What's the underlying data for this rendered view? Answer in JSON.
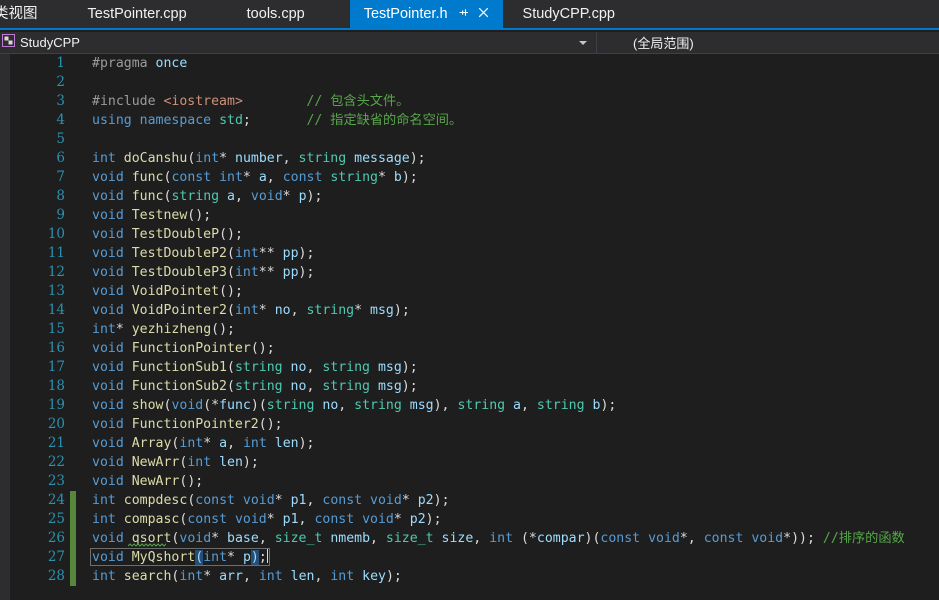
{
  "window": {
    "accent_color": "#007acc",
    "background": "#1e1e1e",
    "chrome_background": "#2d2d30"
  },
  "tabstrip": {
    "tabs": [
      {
        "label": "类视图",
        "active": false,
        "pinned": false
      },
      {
        "label": "TestPointer.cpp",
        "active": false,
        "pinned": false
      },
      {
        "label": "tools.cpp",
        "active": false,
        "pinned": false
      },
      {
        "label": "TestPointer.h",
        "active": true,
        "pinned": true
      },
      {
        "label": "StudyCPP.cpp",
        "active": false,
        "pinned": false
      }
    ],
    "pin_icon": "pin-icon",
    "close_icon": "close-icon"
  },
  "navbar": {
    "project_icon": "project-icon",
    "project_name": "StudyCPP",
    "scope": "(全局范围)",
    "dropdown_icon": "chevron-down-icon"
  },
  "editor": {
    "line_number_color": "#2b91af",
    "change_bar_color": "#57873a",
    "first_visible_line": 1,
    "lines": [
      {
        "n": 1,
        "changed": false,
        "text": "#pragma once"
      },
      {
        "n": 2,
        "changed": false,
        "text": ""
      },
      {
        "n": 3,
        "changed": false,
        "text": "#include <iostream>        // 包含头文件。"
      },
      {
        "n": 4,
        "changed": false,
        "text": "using namespace std;       // 指定缺省的命名空间。"
      },
      {
        "n": 5,
        "changed": false,
        "text": ""
      },
      {
        "n": 6,
        "changed": false,
        "text": "int doCanshu(int* number, string message);"
      },
      {
        "n": 7,
        "changed": false,
        "text": "void func(const int* a, const string* b);"
      },
      {
        "n": 8,
        "changed": false,
        "text": "void func(string a, void* p);"
      },
      {
        "n": 9,
        "changed": false,
        "text": "void Testnew();"
      },
      {
        "n": 10,
        "changed": false,
        "text": "void TestDoubleP();"
      },
      {
        "n": 11,
        "changed": false,
        "text": "void TestDoubleP2(int** pp);"
      },
      {
        "n": 12,
        "changed": false,
        "text": "void TestDoubleP3(int** pp);"
      },
      {
        "n": 13,
        "changed": false,
        "text": "void VoidPointet();"
      },
      {
        "n": 14,
        "changed": false,
        "text": "void VoidPointer2(int* no, string* msg);"
      },
      {
        "n": 15,
        "changed": false,
        "text": "int* yezhizheng();"
      },
      {
        "n": 16,
        "changed": false,
        "text": "void FunctionPointer();"
      },
      {
        "n": 17,
        "changed": false,
        "text": "void FunctionSub1(string no, string msg);"
      },
      {
        "n": 18,
        "changed": false,
        "text": "void FunctionSub2(string no, string msg);"
      },
      {
        "n": 19,
        "changed": false,
        "text": "void show(void(*func)(string no, string msg), string a, string b);"
      },
      {
        "n": 20,
        "changed": false,
        "text": "void FunctionPointer2();"
      },
      {
        "n": 21,
        "changed": false,
        "text": "void Array(int* a, int len);"
      },
      {
        "n": 22,
        "changed": false,
        "text": "void NewArr(int len);"
      },
      {
        "n": 23,
        "changed": false,
        "text": "void NewArr();"
      },
      {
        "n": 24,
        "changed": true,
        "text": "int compdesc(const void* p1, const void* p2);"
      },
      {
        "n": 25,
        "changed": true,
        "text": "int compasc(const void* p1, const void* p2);"
      },
      {
        "n": 26,
        "changed": true,
        "text": "void qsort(void* base, size_t nmemb, size_t size, int (*compar)(const void*, const void*)); //排序的函数"
      },
      {
        "n": 27,
        "changed": true,
        "text": "void MyQshort(int* p);"
      },
      {
        "n": 28,
        "changed": true,
        "text": "int search(int* arr, int len, int key);"
      }
    ],
    "cursor": {
      "line": 27,
      "column": 22
    },
    "current_line": 27,
    "bracket_match": {
      "open": "(",
      "close": ")",
      "highlight_color": "#264f78"
    },
    "squiggle": {
      "line": 26,
      "token": "qsort",
      "color": "#57a64a"
    },
    "syntax_colors": {
      "keyword": "#569cd6",
      "type": "#4ec9b0",
      "function": "#dcdcaa",
      "preprocessor": "#9b9b9b",
      "string": "#ce9178",
      "comment": "#57a64a",
      "identifier": "#9cdcfe",
      "punctuation": "#dcdcdc"
    }
  }
}
